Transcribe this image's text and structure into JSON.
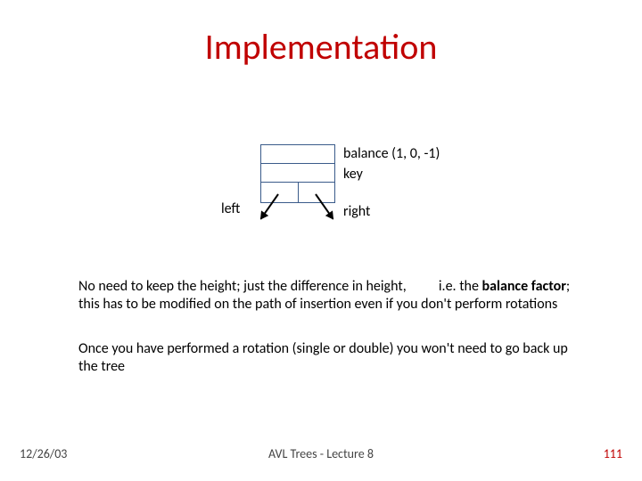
{
  "title": "Implementation",
  "node": {
    "balance_label": "balance (1, 0, -1)",
    "key_label": "key",
    "left_label": "left",
    "right_label": "right"
  },
  "para1": {
    "lead": "No need to keep the height; just the difference in height,",
    "gap": "          ",
    "ie": "i.e. the ",
    "bold": "balance factor",
    "rest": "; this has to be modified on the path of insertion even if you don't perform rotations"
  },
  "para2": "Once you have performed a rotation (single or double) you won't need to go back up the tree",
  "footer": {
    "date": "12/26/03",
    "center": "AVL Trees - Lecture 8",
    "page": "111"
  }
}
